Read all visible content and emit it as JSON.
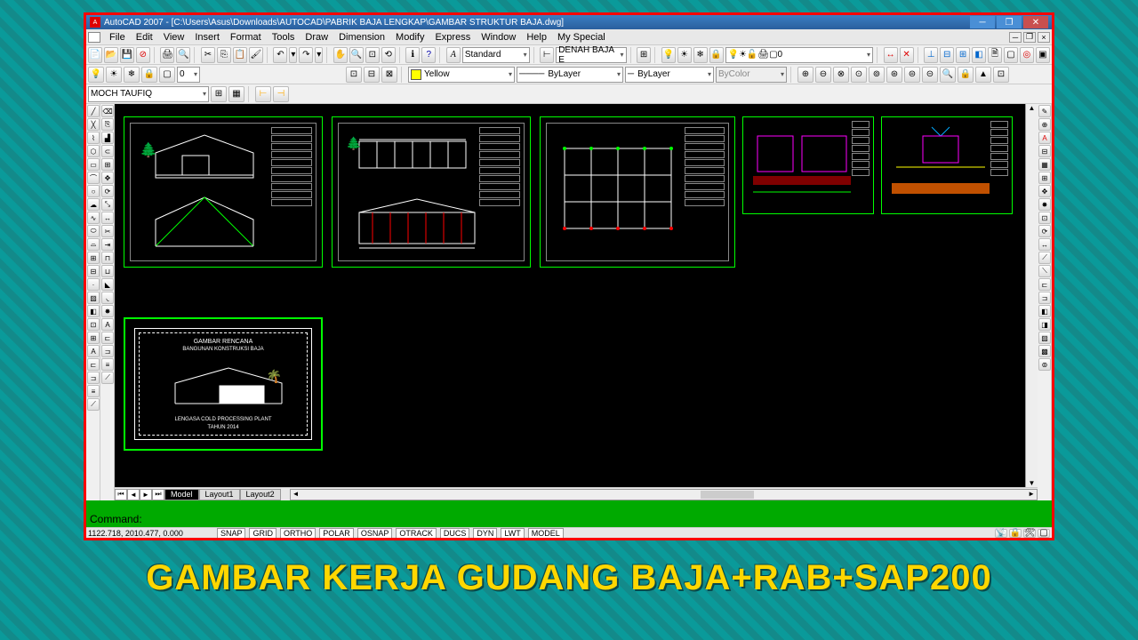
{
  "headline": "GAMBAR KERJA GUDANG BAJA+RAB+SAP200",
  "titlebar": {
    "app": "AutoCAD 2007",
    "path": "[C:\\Users\\Asus\\Downloads\\AUTOCAD\\PABRIK BAJA LENGKAP\\GAMBAR STRUKTUR BAJA.dwg]"
  },
  "menu": [
    "File",
    "Edit",
    "View",
    "Insert",
    "Format",
    "Tools",
    "Draw",
    "Dimension",
    "Modify",
    "Express",
    "Window",
    "Help",
    "My Special"
  ],
  "row1": {
    "style_label": "Standard",
    "dimstyle": "DENAH BAJA E",
    "layer": "0"
  },
  "row2": {
    "color": "Yellow",
    "ltype": "ByLayer",
    "lweight": "ByLayer",
    "plotstyle": "ByColor"
  },
  "row3": {
    "block": "MOCH TAUFIQ"
  },
  "tabs": {
    "model": "Model",
    "l1": "Layout1",
    "l2": "Layout2"
  },
  "command": {
    "prompt": "Command:"
  },
  "status": {
    "coords": "1122.718, 2010.477, 0.000",
    "toggles": [
      "SNAP",
      "GRID",
      "ORTHO",
      "POLAR",
      "OSNAP",
      "OTRACK",
      "DUCS",
      "DYN",
      "LWT",
      "MODEL"
    ]
  },
  "sheet6": {
    "t1": "GAMBAR RENCANA",
    "t2": "BANGUNAN KONSTRUKSI BAJA",
    "t3": "LENGASA COLD PROCESSING PLANT",
    "t4": "TAHUN  2014"
  },
  "icons": {
    "layer_bulb": "💡"
  }
}
